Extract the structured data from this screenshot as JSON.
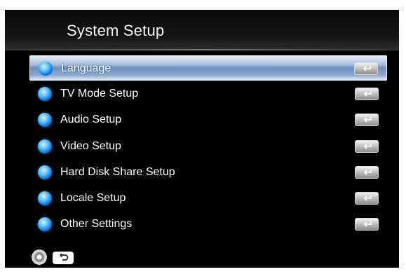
{
  "header": {
    "title": "System Setup"
  },
  "menu": {
    "items": [
      {
        "label": "Language",
        "selected": true,
        "orb_icon": "blue-orb-icon",
        "action_icon": "enter-key-icon"
      },
      {
        "label": "TV Mode Setup",
        "selected": false,
        "orb_icon": "blue-orb-icon",
        "action_icon": "enter-key-icon"
      },
      {
        "label": "Audio Setup",
        "selected": false,
        "orb_icon": "blue-orb-icon",
        "action_icon": "enter-key-icon"
      },
      {
        "label": "Video Setup",
        "selected": false,
        "orb_icon": "blue-orb-icon",
        "action_icon": "enter-key-icon"
      },
      {
        "label": "Hard Disk Share Setup",
        "selected": false,
        "orb_icon": "blue-orb-icon",
        "action_icon": "enter-key-icon"
      },
      {
        "label": "Locale Setup",
        "selected": false,
        "orb_icon": "blue-orb-icon",
        "action_icon": "enter-key-icon"
      },
      {
        "label": "Other Settings",
        "selected": false,
        "orb_icon": "blue-orb-icon",
        "action_icon": "enter-key-icon"
      }
    ]
  },
  "footer": {
    "nav_icon": "remote-dpad-icon",
    "back_icon": "back-return-icon"
  },
  "colors": {
    "background": "#000000",
    "selection": "#8fa9cf",
    "orb": "#2a8fe8",
    "text": "#ffffff"
  }
}
